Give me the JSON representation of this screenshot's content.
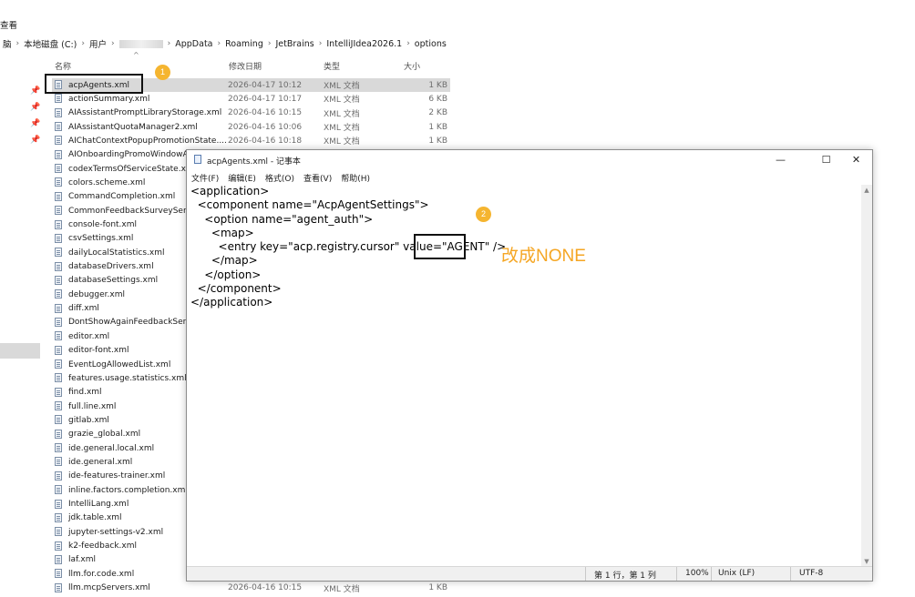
{
  "explorer": {
    "menu_view": "查看",
    "breadcrumb": {
      "prefix_partial": "脑",
      "items": [
        "本地磁盘 (C:)",
        "用户",
        "AppData",
        "Roaming",
        "JetBrains",
        "IntelliJIdea2026.1",
        "options"
      ]
    },
    "columns": {
      "name": "名称",
      "date": "修改日期",
      "type": "类型",
      "size": "大小"
    },
    "files": [
      {
        "name": "acpAgents.xml",
        "date": "2026-04-17 10:12",
        "type": "XML 文档",
        "size": "1 KB",
        "selected": true
      },
      {
        "name": "actionSummary.xml",
        "date": "2026-04-17 10:17",
        "type": "XML 文档",
        "size": "6 KB"
      },
      {
        "name": "AIAssistantPromptLibraryStorage.xml",
        "date": "2026-04-16 10:15",
        "type": "XML 文档",
        "size": "2 KB"
      },
      {
        "name": "AIAssistantQuotaManager2.xml",
        "date": "2026-04-16 10:06",
        "type": "XML 文档",
        "size": "1 KB"
      },
      {
        "name": "AIChatContextPopupPromotionState....",
        "date": "2026-04-16 10:18",
        "type": "XML 文档",
        "size": "1 KB"
      },
      {
        "name": "AIOnboardingPromoWindowA"
      },
      {
        "name": "codexTermsOfServiceState.xml"
      },
      {
        "name": "colors.scheme.xml"
      },
      {
        "name": "CommandCompletion.xml"
      },
      {
        "name": "CommonFeedbackSurveyServic"
      },
      {
        "name": "console-font.xml"
      },
      {
        "name": "csvSettings.xml"
      },
      {
        "name": "dailyLocalStatistics.xml"
      },
      {
        "name": "databaseDrivers.xml"
      },
      {
        "name": "databaseSettings.xml"
      },
      {
        "name": "debugger.xml"
      },
      {
        "name": "diff.xml"
      },
      {
        "name": "DontShowAgainFeedbackServi"
      },
      {
        "name": "editor.xml"
      },
      {
        "name": "editor-font.xml"
      },
      {
        "name": "EventLogAllowedList.xml"
      },
      {
        "name": "features.usage.statistics.xml"
      },
      {
        "name": "find.xml"
      },
      {
        "name": "full.line.xml"
      },
      {
        "name": "gitlab.xml"
      },
      {
        "name": "grazie_global.xml"
      },
      {
        "name": "ide.general.local.xml"
      },
      {
        "name": "ide.general.xml"
      },
      {
        "name": "ide-features-trainer.xml"
      },
      {
        "name": "inline.factors.completion.xml"
      },
      {
        "name": "IntelliLang.xml"
      },
      {
        "name": "jdk.table.xml"
      },
      {
        "name": "jupyter-settings-v2.xml"
      },
      {
        "name": "k2-feedback.xml"
      },
      {
        "name": "laf.xml"
      },
      {
        "name": "llm.for.code.xml"
      },
      {
        "name": "llm.mcpServers.xml",
        "date": "2026-04-16 10:15",
        "type": "XML 文档",
        "size": "1 KB"
      }
    ]
  },
  "notepad": {
    "title": "acpAgents.xml - 记事本",
    "controls": {
      "minimize": "—",
      "maximize": "☐",
      "close": "✕"
    },
    "menu": [
      "文件(F)",
      "编辑(E)",
      "格式(O)",
      "查看(V)",
      "帮助(H)"
    ],
    "lines": [
      "<application>",
      "  <component name=\"AcpAgentSettings\">",
      "    <option name=\"agent_auth\">",
      "      <map>",
      "        <entry key=\"acp.registry.cursor\" value=\"AGENT\" />",
      "      </map>",
      "    </option>",
      "  </component>",
      "</application>"
    ],
    "status": {
      "position": "第 1 行，第 1 列",
      "zoom": "100%",
      "line_ending": "Unix (LF)",
      "encoding": "UTF-8"
    }
  },
  "annotations": {
    "badge1": "1",
    "badge2": "2",
    "note": "改成NONE",
    "badge_color": "#f5b530",
    "note_color": "#f5a623"
  }
}
